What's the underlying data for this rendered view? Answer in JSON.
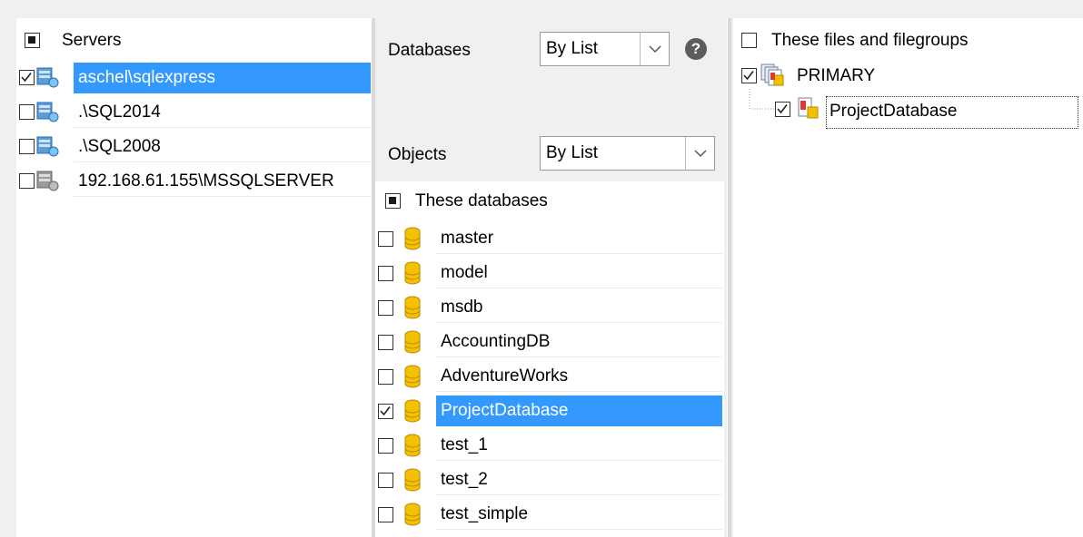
{
  "servers": {
    "header": "Servers",
    "items": [
      {
        "label": "aschel\\sqlexpress",
        "checked": true,
        "selected": true
      },
      {
        "label": ".\\SQL2014",
        "checked": false
      },
      {
        "label": ".\\SQL2008",
        "checked": false
      },
      {
        "label": "192.168.61.155\\MSSQLSERVER",
        "checked": false
      }
    ]
  },
  "settings": {
    "databases_label": "Databases",
    "databases_value": "By List",
    "help_glyph": "?",
    "objects_label": "Objects",
    "objects_value": "By List"
  },
  "databases": {
    "header": "These databases",
    "items": [
      {
        "label": "master",
        "checked": false
      },
      {
        "label": "model",
        "checked": false
      },
      {
        "label": "msdb",
        "checked": false
      },
      {
        "label": "AccountingDB",
        "checked": false
      },
      {
        "label": "AdventureWorks",
        "checked": false
      },
      {
        "label": "ProjectDatabase",
        "checked": true,
        "selected": true
      },
      {
        "label": "test_1",
        "checked": false
      },
      {
        "label": "test_2",
        "checked": false
      },
      {
        "label": "test_simple",
        "checked": false
      }
    ]
  },
  "files": {
    "header": "These files and filegroups",
    "group_label": "PRIMARY",
    "file_label": "ProjectDatabase"
  },
  "colors": {
    "selection": "#3399ff",
    "db_icon": "#f5c000"
  }
}
